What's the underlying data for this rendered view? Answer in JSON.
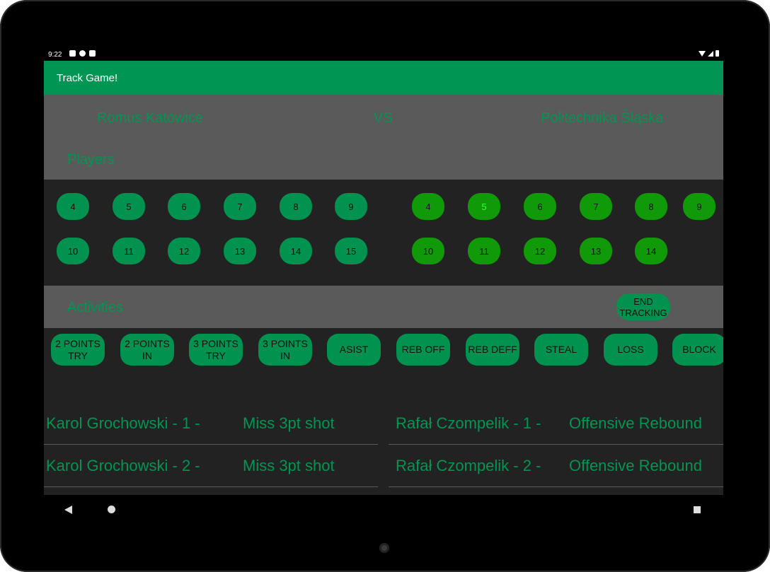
{
  "status": {
    "time": "9:22"
  },
  "app": {
    "title": "Track Game!"
  },
  "match": {
    "team_left": "Romus Katowice",
    "vs": "VS",
    "team_right": "Politechnika Śląska"
  },
  "players_title": "Players",
  "team_left_players": [
    "4",
    "5",
    "6",
    "7",
    "8",
    "9",
    "10",
    "11",
    "12",
    "13",
    "14",
    "15"
  ],
  "team_right_players": [
    "4",
    "5",
    "6",
    "7",
    "8",
    "9",
    "10",
    "11",
    "12",
    "13",
    "14"
  ],
  "selected_right_player": "5",
  "activities_title": "Activities",
  "end_tracking_label": "END TRACKING",
  "actions": [
    "2 POINTS TRY",
    "2 POINTS IN",
    "3 POINTS TRY",
    "3 POINTS IN",
    "ASIST",
    "REB OFF",
    "REB DEFF",
    "STEAL",
    "LOSS",
    "BLOCK"
  ],
  "log_left": [
    {
      "player": "Karol Grochowski - 1 -",
      "action": "Miss 3pt shot"
    },
    {
      "player": "Karol Grochowski - 2 -",
      "action": "Miss 3pt shot"
    }
  ],
  "log_right": [
    {
      "player": "Rafał Czompelik  - 1 -",
      "action": "Offensive Rebound"
    },
    {
      "player": "Rafał Czompelik  - 2 -",
      "action": "Offensive Rebound"
    }
  ],
  "colors": {
    "primary": "#009552",
    "team_left_button": "#00924e",
    "team_right_button": "#119a08",
    "selected_text": "#35ff35",
    "panel_grey": "#5a5a5a",
    "background": "#222222"
  }
}
